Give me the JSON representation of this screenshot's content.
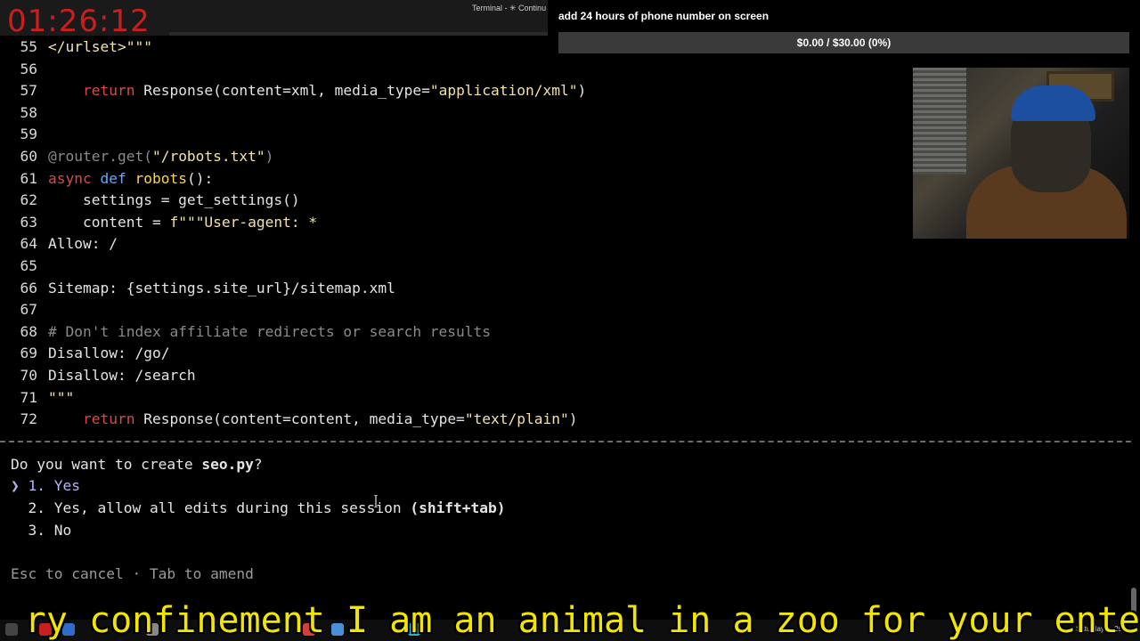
{
  "overlay": {
    "clock": "01:26:12",
    "window_title": "Terminal - ✳ Continu",
    "goal_title": "add 24 hours of phone number on screen",
    "goal_progress": "$0.00 / $30.00 (0%)",
    "goal_fraction": 0.0,
    "caption": "ry confinement I am an animal in a zoo for your ente"
  },
  "editor": {
    "lines": [
      {
        "n": "55",
        "segments": [
          {
            "t": "</urlset>\"\"\"",
            "c": "str"
          }
        ]
      },
      {
        "n": "56",
        "segments": []
      },
      {
        "n": "57",
        "segments": [
          {
            "t": "    ",
            "c": ""
          },
          {
            "t": "return",
            "c": "kw"
          },
          {
            "t": " Response(content=xml, media_type=",
            "c": ""
          },
          {
            "t": "\"application/xml\"",
            "c": "str"
          },
          {
            "t": ")",
            "c": ""
          }
        ]
      },
      {
        "n": "58",
        "segments": []
      },
      {
        "n": "59",
        "segments": []
      },
      {
        "n": "60",
        "segments": [
          {
            "t": "@router.get(",
            "c": "dec"
          },
          {
            "t": "\"/robots.txt\"",
            "c": "str"
          },
          {
            "t": ")",
            "c": "dec"
          }
        ]
      },
      {
        "n": "61",
        "segments": [
          {
            "t": "async",
            "c": "kw"
          },
          {
            "t": " ",
            "c": ""
          },
          {
            "t": "def",
            "c": "kw2"
          },
          {
            "t": " ",
            "c": ""
          },
          {
            "t": "robots",
            "c": "fn"
          },
          {
            "t": "():",
            "c": ""
          }
        ]
      },
      {
        "n": "62",
        "segments": [
          {
            "t": "    settings = get_settings()",
            "c": ""
          }
        ]
      },
      {
        "n": "63",
        "segments": [
          {
            "t": "    content = ",
            "c": ""
          },
          {
            "t": "f\"\"\"User-agent: *",
            "c": "str"
          }
        ]
      },
      {
        "n": "64",
        "segments": [
          {
            "t": "Allow: /",
            "c": ""
          }
        ]
      },
      {
        "n": "65",
        "segments": []
      },
      {
        "n": "66",
        "segments": [
          {
            "t": "Sitemap: {settings.site_url}/sitemap.xml",
            "c": ""
          }
        ]
      },
      {
        "n": "67",
        "segments": []
      },
      {
        "n": "68",
        "segments": [
          {
            "t": "# Don't index affiliate redirects or search results",
            "c": "cm"
          }
        ]
      },
      {
        "n": "69",
        "segments": [
          {
            "t": "Disallow: /go/",
            "c": ""
          }
        ]
      },
      {
        "n": "70",
        "segments": [
          {
            "t": "Disallow: /search",
            "c": ""
          }
        ]
      },
      {
        "n": "71",
        "segments": [
          {
            "t": "\"\"\"",
            "c": "str"
          }
        ]
      },
      {
        "n": "72",
        "segments": [
          {
            "t": "    ",
            "c": ""
          },
          {
            "t": "return",
            "c": "kw"
          },
          {
            "t": " Response(content=content, media_type=",
            "c": ""
          },
          {
            "t": "\"text/plain\"",
            "c": "str"
          },
          {
            "t": ")",
            "c": ""
          }
        ]
      }
    ]
  },
  "dialog": {
    "question_prefix": "Do you want to create ",
    "question_file": "seo.py",
    "question_suffix": "?",
    "cursor": "❯",
    "options": [
      {
        "num": "1.",
        "label": "Yes",
        "shortcut": ""
      },
      {
        "num": "2.",
        "label": "Yes, allow all edits during this session",
        "shortcut": "(shift+tab)"
      },
      {
        "num": "3.",
        "label": "No",
        "shortcut": ""
      }
    ],
    "hint": "Esc to cancel · Tab to amend"
  },
  "taskbar": {
    "tray_text": "Saturday ... 29"
  }
}
